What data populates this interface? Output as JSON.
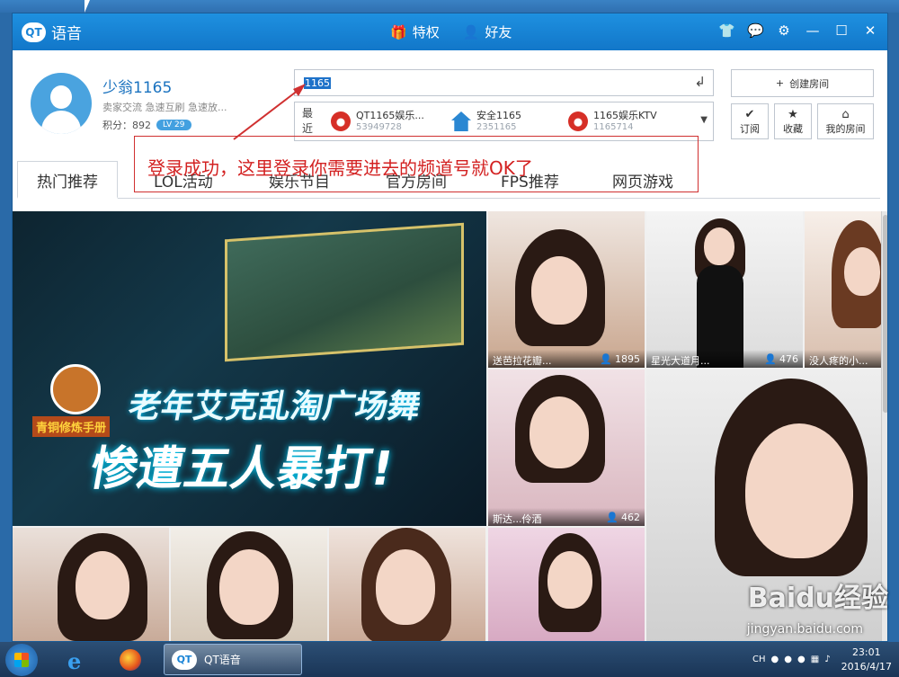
{
  "app": {
    "name": "语音",
    "logo_badge": "QT"
  },
  "titlebar": {
    "nav": [
      {
        "label": "特权",
        "icon": "gift-icon"
      },
      {
        "label": "好友",
        "icon": "user-icon"
      }
    ],
    "window_controls": [
      "skin-icon",
      "message-icon",
      "settings-icon",
      "minimize-icon",
      "maximize-icon",
      "close-icon"
    ]
  },
  "profile": {
    "name": "少翁1165",
    "tags": "卖家交流 急速互刷 急速放...",
    "score_label": "积分：892",
    "level": "LV 29"
  },
  "search": {
    "value": "1165",
    "enter_icon": "enter-icon"
  },
  "recent": {
    "label": "最近",
    "items": [
      {
        "name": "QT1165娱乐...",
        "id": "53949728",
        "icon": "red"
      },
      {
        "name": "安全1165",
        "id": "2351165",
        "icon": "blue"
      },
      {
        "name": "1165娱乐KTV",
        "id": "1165714",
        "icon": "red"
      }
    ]
  },
  "actions": {
    "create_room": "创建房间",
    "subscribe": "订阅",
    "favorite": "收藏",
    "my_room": "我的房间"
  },
  "tabs": [
    "热门推荐",
    "LOL活动",
    "娱乐节目",
    "官方房间",
    "FPS推荐",
    "网页游戏"
  ],
  "annotation": "登录成功，这里登录你需要进去的频道号就OK了",
  "banner": {
    "line1": "老年艾克乱淘广场舞",
    "line2": "惨遭五人暴打!",
    "badge": "青铜修炼手册"
  },
  "tiles": [
    {
      "caption": "送芭拉花瓣...",
      "count": "1895"
    },
    {
      "caption": "星光大道月...",
      "count": "476"
    },
    {
      "caption": "没人疼的小...",
      "count": ""
    },
    {
      "caption": "斯达...伶酒",
      "count": "462"
    }
  ],
  "taskbar": {
    "app_label": "QT语音",
    "lang": "CH",
    "time": "23:01",
    "date": "2016/4/17"
  },
  "watermark": {
    "brand": "Baidu经验",
    "url": "jingyan.baidu.com"
  },
  "colors": {
    "titlebar": "#1a84d6",
    "annotation": "#d32121",
    "level_badge": "#43a0e0"
  }
}
